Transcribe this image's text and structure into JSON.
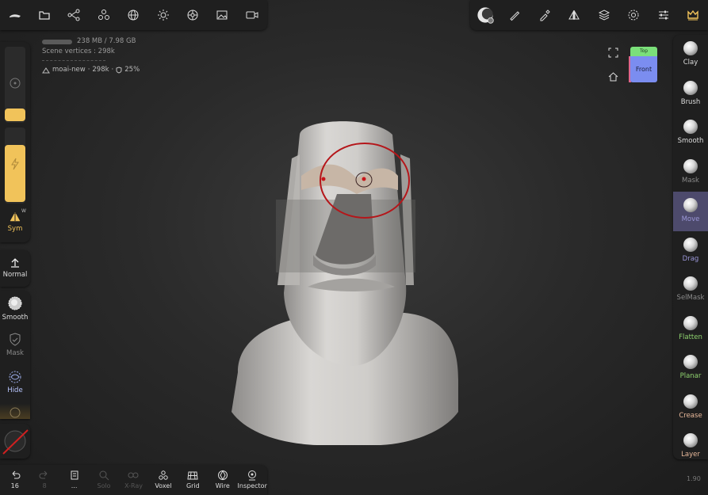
{
  "top_toolbar_left": {
    "icons": [
      "hat-icon",
      "folder-icon",
      "scene-graph-icon",
      "shapes-icon",
      "sphere-grid-icon",
      "light-icon",
      "material-icon",
      "image-icon",
      "camera-icon"
    ]
  },
  "top_toolbar_right": {
    "icons": [
      "material-ball-icon",
      "stroke-icon",
      "picker-icon",
      "symmetry-icon",
      "layers-icon",
      "settings-icon",
      "sliders-icon",
      "crown-icon"
    ]
  },
  "info": {
    "memory": "238 MB / 7.98 GB",
    "scene_vertices": "Scene vertices : 298k",
    "mesh_name": "moai-new",
    "mesh_vertices": "298k",
    "mesh_percent": "25%"
  },
  "left_panel": {
    "radius_fill": 0.12,
    "intensity_fill": 0.7,
    "sym_label": "Sym",
    "sym_badge": "W",
    "normal_label": "Normal",
    "smooth_label": "Smooth",
    "mask_label": "Mask",
    "hide_label": "Hide"
  },
  "right_tools": [
    {
      "label": "Clay",
      "color": "#dddddd"
    },
    {
      "label": "Brush",
      "color": "#dddddd"
    },
    {
      "label": "Smooth",
      "color": "#dddddd"
    },
    {
      "label": "Mask",
      "color": "#8a8a8a"
    },
    {
      "label": "Move",
      "color": "#9b97d8",
      "active": true
    },
    {
      "label": "Drag",
      "color": "#9b97d8"
    },
    {
      "label": "SelMask",
      "color": "#8a8a8a"
    },
    {
      "label": "Flatten",
      "color": "#8fd36f"
    },
    {
      "label": "Planar",
      "color": "#8fd36f"
    },
    {
      "label": "Crease",
      "color": "#e8b89a"
    },
    {
      "label": "Layer",
      "color": "#e8b89a"
    }
  ],
  "bottom_bar": [
    {
      "label": "16",
      "icon": "undo-icon",
      "dim": false
    },
    {
      "label": "8",
      "icon": "redo-icon",
      "dim": true
    },
    {
      "label": "...",
      "icon": "trash-icon",
      "dim": false
    },
    {
      "label": "Solo",
      "icon": "solo-icon",
      "dim": true
    },
    {
      "label": "X-Ray",
      "icon": "xray-icon",
      "dim": true
    },
    {
      "label": "Voxel",
      "icon": "voxel-icon",
      "dim": false
    },
    {
      "label": "Grid",
      "icon": "grid-icon",
      "dim": false
    },
    {
      "label": "Wire",
      "icon": "wire-icon",
      "dim": false
    },
    {
      "label": "Inspector",
      "icon": "inspector-icon",
      "dim": false
    }
  ],
  "view_cube": {
    "top": "Top",
    "front": "Front"
  },
  "version": "1.90",
  "colors": {
    "accent": "#f1c35a",
    "panel": "#1f1f1f",
    "active_tool": "#4d4a6c",
    "brush_circle": "#b5161a"
  }
}
